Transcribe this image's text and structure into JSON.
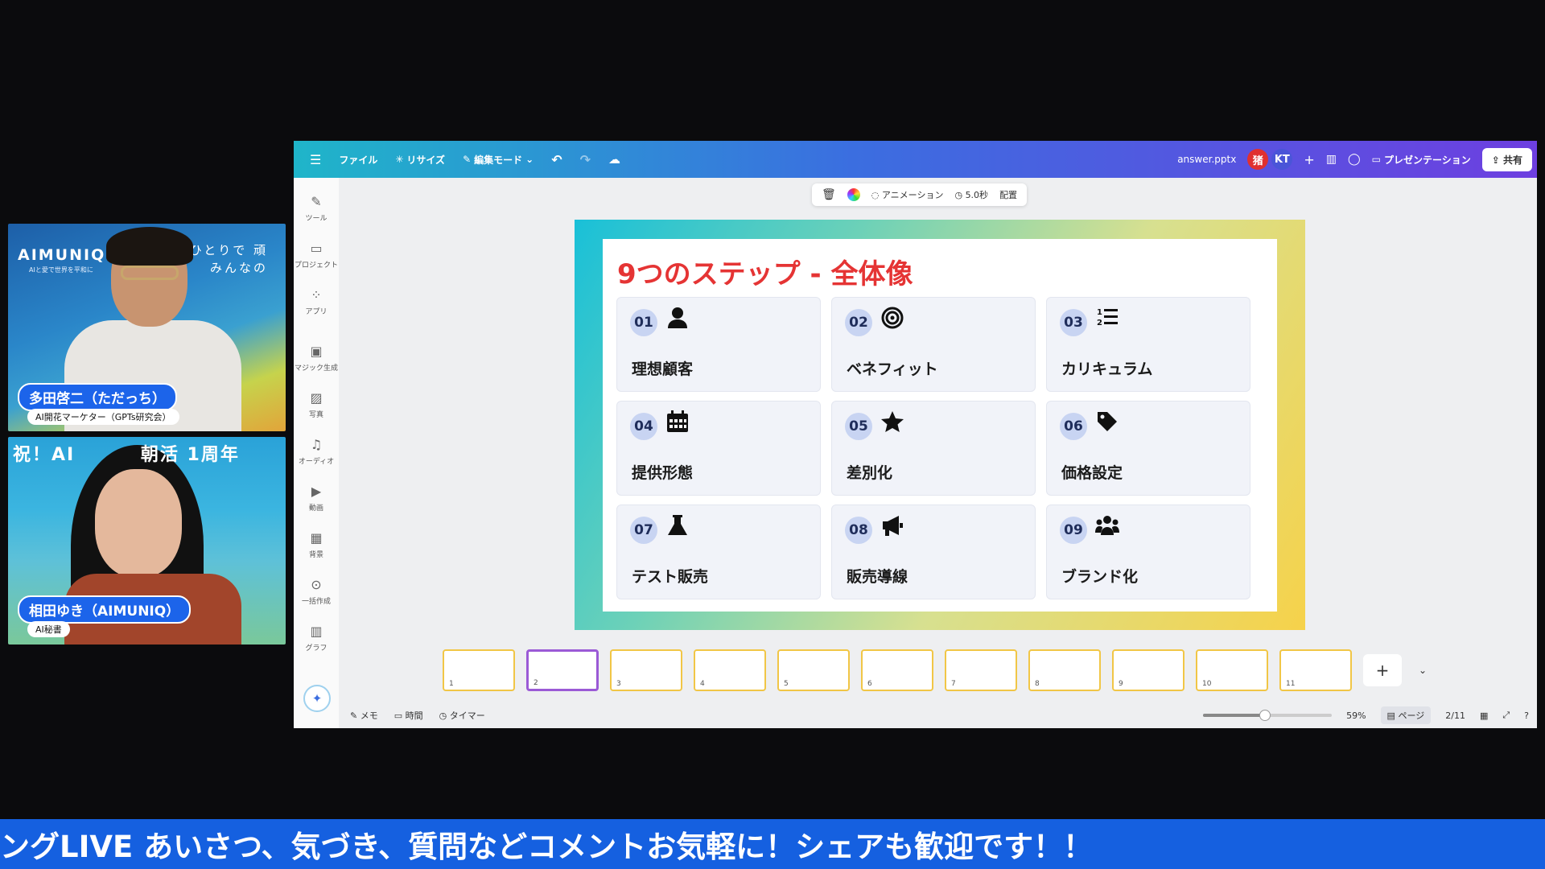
{
  "camera1": {
    "brand": "AIMUNIQ",
    "brand_sub": "AIと愛で世界を平和に",
    "tagline_line1": "ひとりで 頑",
    "tagline_line2": "みんなの",
    "name": "多田啓二（ただっち）",
    "role": "AI開花マーケター（GPTs研究会）"
  },
  "camera2": {
    "headline": "祝！AI　　　 朝活 1周年",
    "name": "相田ゆき（AIMUNIQ）",
    "role": "AI秘書"
  },
  "topbar": {
    "menu_icon": "hamburger-icon",
    "file": "ファイル",
    "resize": "リサイズ",
    "edit_mode": "編集モード",
    "filename": "answer.pptx",
    "avatar1": "猪",
    "avatar2": "KT",
    "present": "プレゼンテーション",
    "share": "共有"
  },
  "sidebar": {
    "items": [
      {
        "icon": "pen-tool-icon",
        "label": "ツール"
      },
      {
        "icon": "folder-icon",
        "label": "プロジェクト"
      },
      {
        "icon": "apps-icon",
        "label": "アプリ"
      },
      {
        "icon": "magic-image-icon",
        "label": "マジック生成"
      },
      {
        "icon": "photo-icon",
        "label": "写真"
      },
      {
        "icon": "music-note-icon",
        "label": "オーディオ"
      },
      {
        "icon": "video-icon",
        "label": "動画"
      },
      {
        "icon": "background-icon",
        "label": "背景"
      },
      {
        "icon": "bulk-create-icon",
        "label": "一括作成"
      },
      {
        "icon": "chart-icon",
        "label": "グラフ"
      }
    ]
  },
  "floatbar": {
    "animation": "アニメーション",
    "duration": "5.0秒",
    "arrange": "配置"
  },
  "slide": {
    "title": "9つのステップ - 全体像",
    "cards": [
      {
        "num": "01",
        "label": "理想顧客",
        "icon": "user-icon"
      },
      {
        "num": "02",
        "label": "ベネフィット",
        "icon": "target-icon"
      },
      {
        "num": "03",
        "label": "カリキュラム",
        "icon": "ordered-list-icon"
      },
      {
        "num": "04",
        "label": "提供形態",
        "icon": "calendar-icon"
      },
      {
        "num": "05",
        "label": "差別化",
        "icon": "star-icon"
      },
      {
        "num": "06",
        "label": "価格設定",
        "icon": "tag-icon"
      },
      {
        "num": "07",
        "label": "テスト販売",
        "icon": "flask-icon"
      },
      {
        "num": "08",
        "label": "販売導線",
        "icon": "megaphone-icon"
      },
      {
        "num": "09",
        "label": "ブランド化",
        "icon": "users-icon"
      }
    ]
  },
  "thumbnails": [
    "1",
    "2",
    "3",
    "4",
    "5",
    "6",
    "7",
    "8",
    "9",
    "10",
    "11"
  ],
  "thumbnail_selected_page": 2,
  "bottombar": {
    "memo": "メモ",
    "time": "時間",
    "timer": "タイマー",
    "zoom": "59%",
    "page_view": "ページ",
    "page": "2/11"
  },
  "ticker": {
    "text": "ングLIVE あいさつ、気づき、質問などコメントお気軽に！シェアも歓迎です！！"
  },
  "colors": {
    "title_red": "#e53434",
    "ticker_blue": "#1560e0",
    "name_pill_blue": "#1c64ea"
  }
}
